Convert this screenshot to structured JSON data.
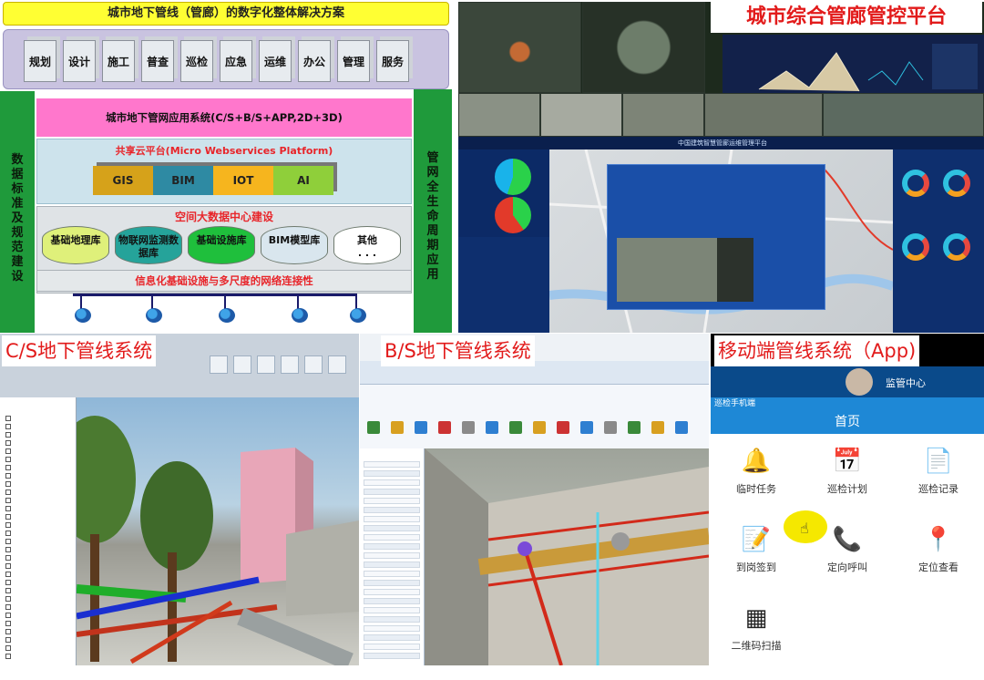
{
  "architecture": {
    "title": "城市地下管线（管廊）的数字化整体解决方案",
    "lifecycle_stages": [
      "规划",
      "设计",
      "施工",
      "普查",
      "巡检",
      "应急",
      "运维",
      "办公",
      "管理",
      "服务"
    ],
    "left_side_label": "数据标准及规范建设",
    "right_side_label": "管网全生命周期应用",
    "app_system": "城市地下管网应用系统(C/S+B/S+APP,2D+3D)",
    "cloud_platform": "共享云平台(Micro Webservices Platform)",
    "tech_chips": [
      {
        "label": "GIS",
        "color": "#d6a21a"
      },
      {
        "label": "BIM",
        "color": "#2e8aa3"
      },
      {
        "label": "IOT",
        "color": "#f6b51e"
      },
      {
        "label": "AI",
        "color": "#8fcf3a"
      }
    ],
    "bigdata_center": "空间大数据中心建设",
    "databases": [
      {
        "label": "基础地理库",
        "color": "#dff07a"
      },
      {
        "label": "物联网监测数据库",
        "color": "#25a39a"
      },
      {
        "label": "基础设施库",
        "color": "#1fbf3c"
      },
      {
        "label": "BIM模型库",
        "color": "#d9e6ee"
      },
      {
        "label": "其他",
        "color": "#ffffff"
      }
    ],
    "infrastructure": "信息化基础设施与多尺度的网络连接性"
  },
  "monitoring": {
    "label": "城市综合管廊管控平台",
    "dashboard_title": "中国建筑智慧管廊运维管理平台"
  },
  "cs_system": {
    "label": "C/S地下管线系统"
  },
  "bs_system": {
    "label": "B/S地下管线系统"
  },
  "mobile": {
    "label": "移动端管线系统（App)",
    "header_text": "监管中心",
    "app_title": "巡检手机端",
    "home_title": "首页",
    "items": [
      {
        "label": "临时任务",
        "icon": "bell-icon",
        "color": "#f0a030"
      },
      {
        "label": "巡检计划",
        "icon": "calendar-icon",
        "color": "#2e7fd1"
      },
      {
        "label": "巡检记录",
        "icon": "document-icon",
        "color": "#c8b24a"
      },
      {
        "label": "到岗签到",
        "icon": "signin-icon",
        "color": "#f0a030"
      },
      {
        "label": "定向呼叫",
        "icon": "phone-icon",
        "color": "#2a9a3a"
      },
      {
        "label": "定位查看",
        "icon": "location-icon",
        "color": "#d9403a"
      },
      {
        "label": "二维码扫描",
        "icon": "qrcode-icon",
        "color": "#222222"
      }
    ]
  }
}
